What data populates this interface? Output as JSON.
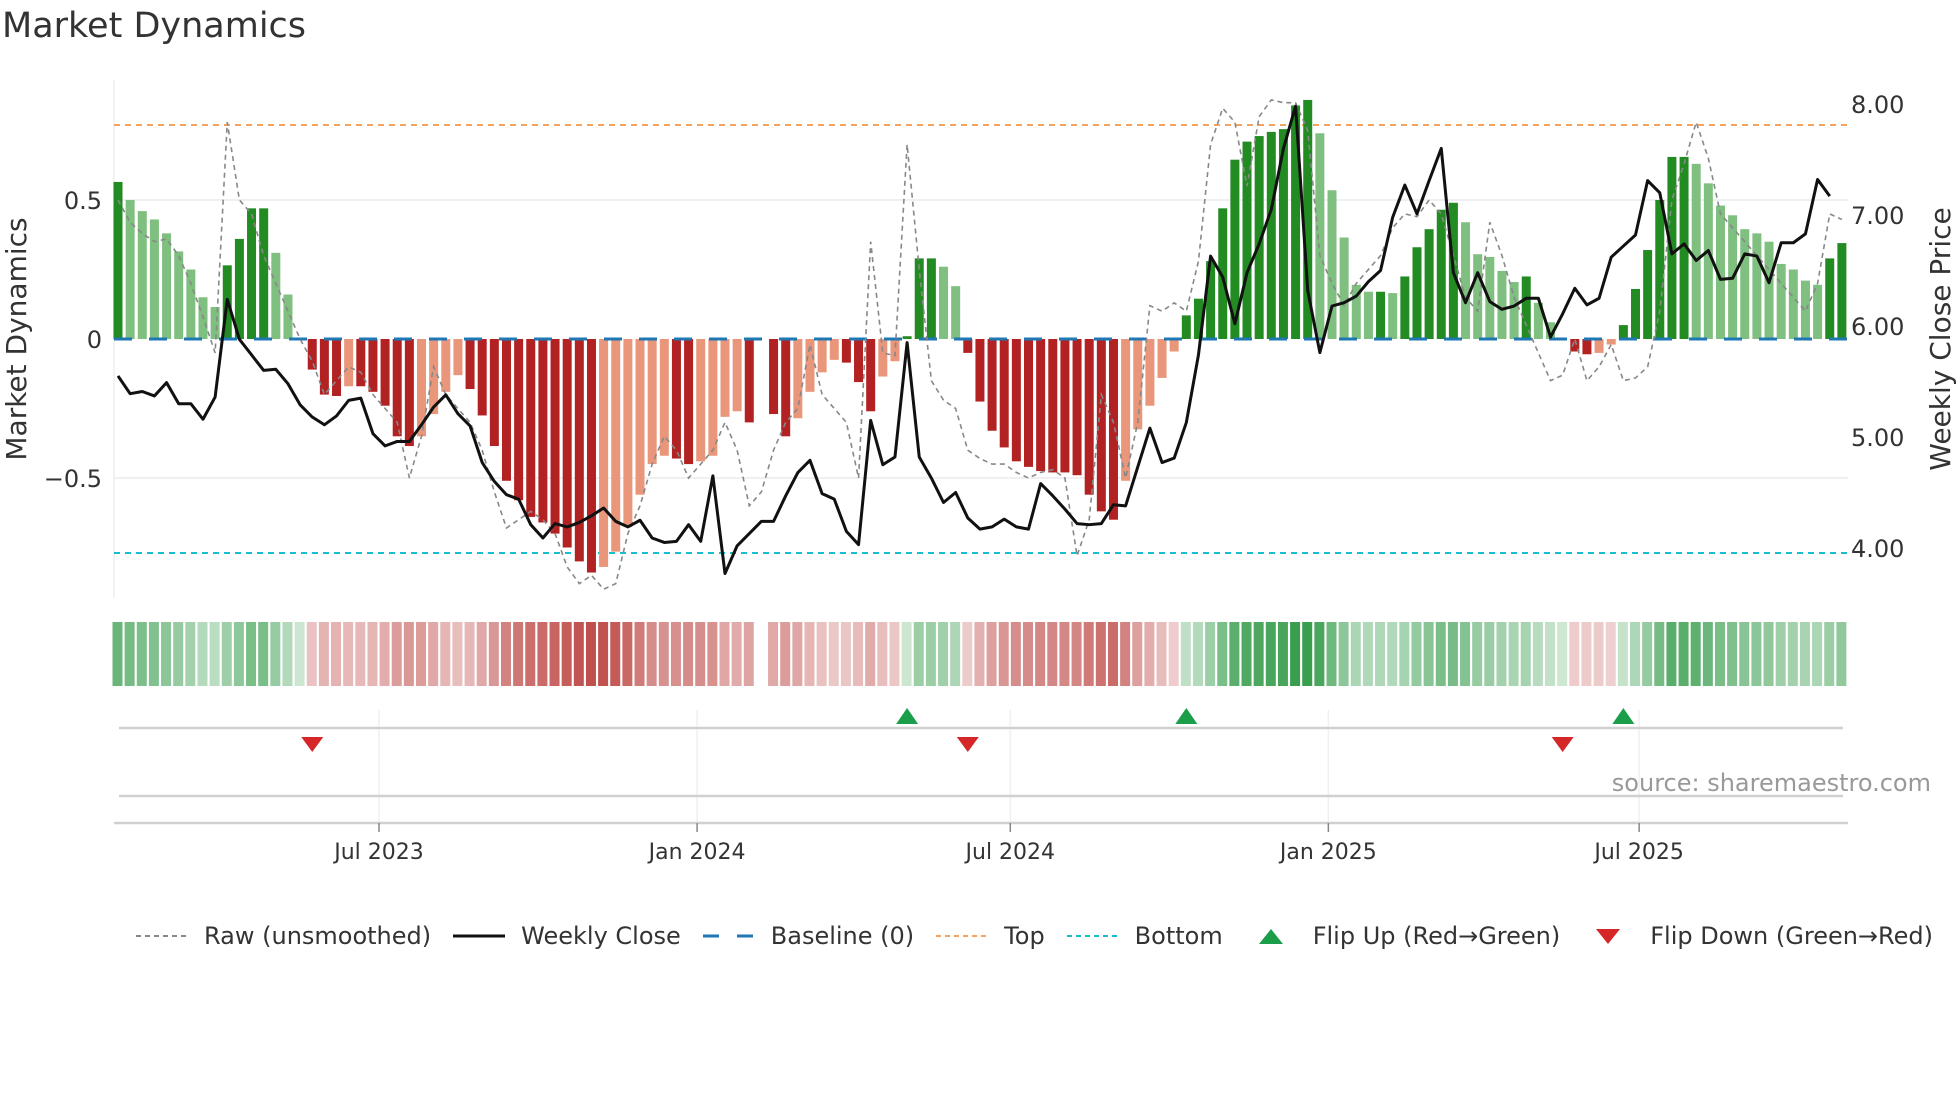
{
  "title": "Market Dynamics",
  "source": "source: sharemaestro.com",
  "colors": {
    "dark_green": "#228b22",
    "light_green": "#7fbf7f",
    "dark_red": "#b22222",
    "light_red": "#e9967a",
    "baseline": "#1f77b4",
    "top": "#f4a460",
    "bottom": "#17becf",
    "close": "#111111",
    "raw": "#888888",
    "flip_up": "#1a9e4a",
    "flip_down": "#d62728"
  },
  "legend": [
    {
      "key": "raw",
      "label": "Raw (unsmoothed)"
    },
    {
      "key": "close",
      "label": "Weekly Close"
    },
    {
      "key": "baseline",
      "label": "Baseline (0)"
    },
    {
      "key": "top",
      "label": "Top"
    },
    {
      "key": "bottom",
      "label": "Bottom"
    },
    {
      "key": "flip_up",
      "label": "Flip Up (Red→Green)"
    },
    {
      "key": "flip_down",
      "label": "Flip Down (Green→Red)"
    }
  ],
  "chart_data": {
    "type": "bar",
    "title": "Market Dynamics",
    "ylabel": "Market Dynamics",
    "y2label": "Weekly Close Price",
    "ylim": [
      -0.93,
      0.93
    ],
    "y2lim": [
      3.6,
      8.2
    ],
    "yticks": [
      {
        "v": 0.5,
        "label": "0.5"
      },
      {
        "v": 0,
        "label": "0"
      },
      {
        "v": -0.5,
        "label": "−0.5"
      }
    ],
    "y2ticks": [
      {
        "v": 8,
        "label": "8.00"
      },
      {
        "v": 7,
        "label": "7.00"
      },
      {
        "v": 6,
        "label": "6.00"
      },
      {
        "v": 5,
        "label": "5.00"
      },
      {
        "v": 4,
        "label": "4.00"
      }
    ],
    "xticks": [
      {
        "week": 21.5,
        "label": "Jul 2023"
      },
      {
        "week": 47.7,
        "label": "Jan 2024"
      },
      {
        "week": 73.5,
        "label": "Jul 2024"
      },
      {
        "week": 99.7,
        "label": "Jan 2025"
      },
      {
        "week": 125.3,
        "label": "Jul 2025"
      }
    ],
    "top_level": 0.77,
    "bottom_level": -0.77,
    "baseline": 0,
    "dynamics": [
      0.565,
      0.5,
      0.46,
      0.43,
      0.38,
      0.315,
      0.25,
      0.15,
      0.115,
      0.265,
      0.36,
      0.47,
      0.47,
      0.31,
      0.16,
      0.005,
      -0.11,
      -0.2,
      -0.205,
      -0.17,
      -0.17,
      -0.19,
      -0.24,
      -0.35,
      -0.385,
      -0.35,
      -0.27,
      -0.19,
      -0.13,
      -0.18,
      -0.275,
      -0.385,
      -0.51,
      -0.58,
      -0.64,
      -0.66,
      -0.7,
      -0.75,
      -0.8,
      -0.84,
      -0.82,
      -0.765,
      -0.675,
      -0.56,
      -0.45,
      -0.42,
      -0.43,
      -0.45,
      -0.44,
      -0.42,
      -0.28,
      -0.26,
      -0.3,
      null,
      -0.27,
      -0.35,
      -0.285,
      -0.19,
      -0.12,
      -0.075,
      -0.085,
      -0.155,
      -0.26,
      -0.135,
      -0.08,
      0.01,
      0.29,
      0.29,
      0.26,
      0.19,
      -0.05,
      -0.225,
      -0.33,
      -0.39,
      -0.44,
      -0.46,
      -0.475,
      -0.48,
      -0.48,
      -0.49,
      -0.56,
      -0.62,
      -0.65,
      -0.51,
      -0.325,
      -0.24,
      -0.14,
      -0.045,
      0.085,
      0.145,
      0.28,
      0.47,
      0.645,
      0.71,
      0.73,
      0.745,
      0.755,
      0.84,
      0.86,
      0.74,
      0.535,
      0.365,
      0.195,
      0.17,
      0.17,
      0.165,
      0.225,
      0.33,
      0.395,
      0.465,
      0.49,
      0.42,
      0.305,
      0.295,
      0.245,
      0.205,
      0.225,
      0.13,
      0.06,
      0.0,
      -0.045,
      -0.055,
      -0.05,
      -0.02,
      0.05,
      0.18,
      0.32,
      0.5,
      0.655,
      0.655,
      0.63,
      0.56,
      0.48,
      0.445,
      0.395,
      0.38,
      0.35,
      0.27,
      0.25,
      0.21,
      0.195,
      0.29,
      0.345
    ],
    "raw": [
      0.5,
      0.42,
      0.38,
      0.35,
      0.36,
      0.3,
      0.2,
      0.08,
      -0.05,
      0.78,
      0.5,
      0.45,
      0.3,
      0.2,
      0.1,
      0.0,
      -0.08,
      -0.2,
      -0.15,
      -0.1,
      -0.12,
      -0.2,
      -0.25,
      -0.3,
      -0.5,
      -0.35,
      -0.1,
      -0.2,
      -0.25,
      -0.3,
      -0.4,
      -0.55,
      -0.68,
      -0.65,
      -0.62,
      -0.65,
      -0.7,
      -0.82,
      -0.88,
      -0.85,
      -0.9,
      -0.88,
      -0.7,
      -0.6,
      -0.45,
      -0.35,
      -0.4,
      -0.5,
      -0.45,
      -0.4,
      -0.3,
      -0.4,
      -0.6,
      -0.55,
      -0.4,
      -0.3,
      -0.25,
      -0.02,
      -0.2,
      -0.25,
      -0.3,
      -0.5,
      0.35,
      -0.05,
      -0.06,
      0.7,
      0.25,
      -0.15,
      -0.22,
      -0.25,
      -0.4,
      -0.43,
      -0.45,
      -0.45,
      -0.48,
      -0.5,
      -0.48,
      -0.47,
      -0.5,
      -0.78,
      -0.65,
      -0.2,
      -0.3,
      -0.5,
      -0.3,
      0.12,
      0.1,
      0.13,
      0.1,
      0.28,
      0.7,
      0.83,
      0.78,
      0.55,
      0.8,
      0.86,
      0.85,
      0.85,
      0.75,
      0.3,
      0.2,
      0.12,
      0.2,
      0.25,
      0.3,
      0.4,
      0.45,
      0.44,
      0.5,
      0.45,
      0.3,
      0.15,
      0.1,
      0.42,
      0.3,
      0.15,
      0.05,
      -0.05,
      -0.15,
      -0.13,
      0.0,
      -0.15,
      -0.1,
      -0.02,
      -0.15,
      -0.14,
      -0.1,
      0.1,
      0.5,
      0.63,
      0.78,
      0.65,
      0.45,
      0.4,
      0.35,
      0.3,
      0.25,
      0.2,
      0.15,
      0.1,
      0.2,
      0.45,
      0.43
    ],
    "close": [
      5.55,
      5.39,
      5.41,
      5.37,
      5.49,
      5.3,
      5.3,
      5.16,
      5.36,
      6.24,
      5.88,
      5.74,
      5.6,
      5.61,
      5.48,
      5.29,
      5.18,
      5.11,
      5.19,
      5.33,
      5.35,
      5.03,
      4.92,
      4.96,
      4.96,
      5.11,
      5.27,
      5.38,
      5.21,
      5.1,
      4.77,
      4.6,
      4.48,
      4.44,
      4.21,
      4.09,
      4.22,
      4.19,
      4.23,
      4.29,
      4.36,
      4.24,
      4.19,
      4.25,
      4.09,
      4.05,
      4.06,
      4.21,
      4.06,
      4.65,
      3.77,
      4.02,
      4.13,
      4.24,
      4.24,
      4.47,
      4.68,
      4.79,
      4.49,
      4.44,
      4.15,
      4.03,
      5.15,
      4.75,
      4.82,
      5.85,
      4.82,
      4.63,
      4.41,
      4.5,
      4.27,
      4.17,
      4.19,
      4.26,
      4.19,
      4.17,
      4.58,
      4.47,
      4.35,
      4.22,
      4.21,
      4.22,
      4.39,
      4.38,
      4.73,
      5.08,
      4.77,
      4.81,
      5.13,
      5.74,
      6.63,
      6.44,
      6.02,
      6.48,
      6.74,
      7.05,
      7.6,
      7.98,
      6.32,
      5.76,
      6.18,
      6.21,
      6.27,
      6.4,
      6.5,
      6.98,
      7.27,
      7.01,
      7.31,
      7.6,
      6.48,
      6.21,
      6.48,
      6.22,
      6.15,
      6.18,
      6.25,
      6.25,
      5.9,
      6.11,
      6.34,
      6.19,
      6.25,
      6.62,
      6.72,
      6.82,
      7.31,
      7.2,
      6.65,
      6.74,
      6.59,
      6.68,
      6.42,
      6.43,
      6.65,
      6.63,
      6.39,
      6.75,
      6.75,
      6.83,
      7.32,
      7.17
    ],
    "flips_up_week": [
      65,
      88,
      124
    ],
    "flips_down_week": [
      16,
      70,
      119
    ]
  }
}
